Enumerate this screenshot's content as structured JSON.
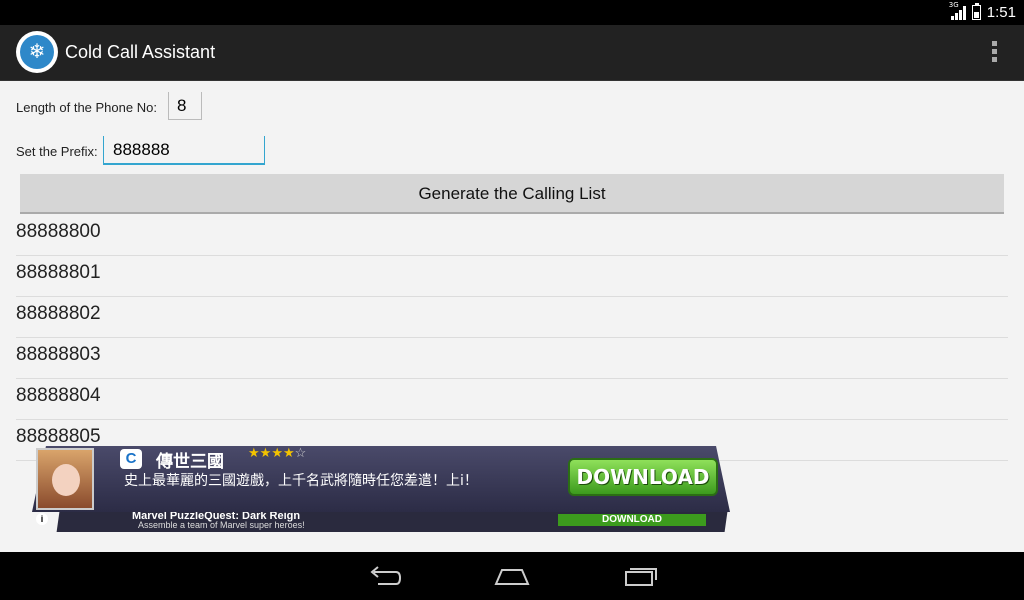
{
  "status_bar": {
    "network": "3G",
    "time": "1:51"
  },
  "action_bar": {
    "app_title": "Cold Call Assistant",
    "app_icon": "snowflake-logo-icon",
    "overflow_icon": "overflow-menu-icon"
  },
  "form": {
    "length_label": "Length of the Phone No:",
    "length_value": "8",
    "prefix_label": "Set the Prefix:",
    "prefix_value": "888888",
    "generate_button": "Generate the Calling List"
  },
  "calling_list": [
    "88888800",
    "88888801",
    "88888802",
    "88888803",
    "88888804",
    "88888805"
  ],
  "ad": {
    "title": "傳世三國",
    "rating": 4,
    "rating_max": 5,
    "description": "史上最華麗的三國遊戲，上千名武將隨時任您差遣！上i！",
    "download_label": "DOWNLOAD",
    "secondary_title": "Marvel PuzzleQuest: Dark Reign",
    "secondary_subtitle": "Assemble a team of Marvel super heroes!",
    "secondary_download_label": "DOWNLOAD",
    "info_icon": "info-icon",
    "star_color": "#f3c300",
    "button_color": "#5bb82e"
  },
  "nav_bar": {
    "back_icon": "back-icon",
    "home_icon": "home-icon",
    "recents_icon": "recents-icon"
  },
  "colors": {
    "accent": "#33a5cf",
    "action_bar_bg": "#222222",
    "background": "#f3f3f3"
  }
}
